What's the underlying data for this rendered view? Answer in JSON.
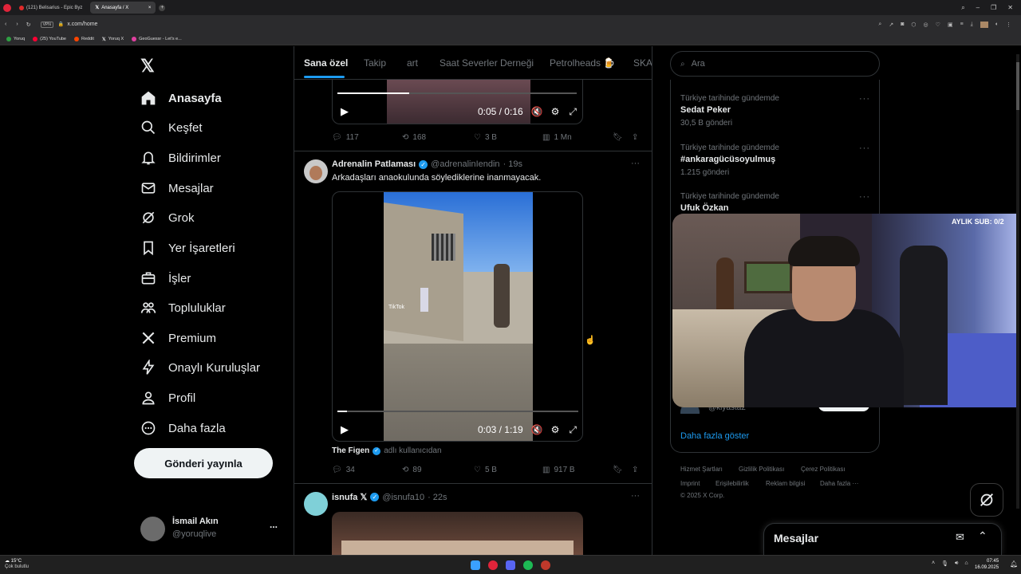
{
  "browser": {
    "tabs": [
      {
        "label": "(121) Belisarius - Epic Byz"
      },
      {
        "label": "Anasayfa / X"
      }
    ],
    "url": "x.com/home",
    "vpn": "VPN",
    "bookmarks": [
      {
        "label": "Yoruq",
        "color": "#2ea043"
      },
      {
        "label": "(25) YouTube",
        "color": "#ff0033"
      },
      {
        "label": "Reddit",
        "color": "#ff4500"
      },
      {
        "label": "Yoruq X",
        "color": "#ffffff"
      },
      {
        "label": "GeoGuessr - Let's e...",
        "color": "#e040a0"
      }
    ]
  },
  "sidebar": {
    "items": [
      {
        "label": "Anasayfa",
        "icon": "home-icon"
      },
      {
        "label": "Keşfet",
        "icon": "search-icon"
      },
      {
        "label": "Bildirimler",
        "icon": "bell-icon"
      },
      {
        "label": "Mesajlar",
        "icon": "mail-icon"
      },
      {
        "label": "Grok",
        "icon": "grok-icon"
      },
      {
        "label": "Yer İşaretleri",
        "icon": "bookmark-icon"
      },
      {
        "label": "İşler",
        "icon": "briefcase-icon"
      },
      {
        "label": "Topluluklar",
        "icon": "people-icon"
      },
      {
        "label": "Premium",
        "icon": "x-logo-icon"
      },
      {
        "label": "Onaylı Kuruluşlar",
        "icon": "lightning-icon"
      },
      {
        "label": "Profil",
        "icon": "person-icon"
      },
      {
        "label": "Daha fazla",
        "icon": "more-circle-icon"
      }
    ],
    "post_button": "Gönderi yayınla",
    "account": {
      "name": "İsmail Akın",
      "handle": "@yoruqlive",
      "more": "..."
    }
  },
  "feed": {
    "tabs": [
      "Sana özel",
      "Takip",
      "art",
      "Saat Severler Derneği",
      "Petrolheads 🍺",
      "SKA"
    ],
    "post1": {
      "video_time": "0:05 / 0:16",
      "video_progress": 0.3,
      "stats": {
        "replies": "117",
        "reposts": "168",
        "likes": "3 B",
        "views": "1 Mn"
      }
    },
    "post2": {
      "name": "Adrenalin Patlaması",
      "handle": "@adrenalinIendin",
      "time": "· 19s",
      "text": "Arkadaşları anaokulunda söylediklerine inanmayacak.",
      "video_time": "0:03 / 1:19",
      "video_progress": 0.04,
      "watermark": "TikTok",
      "source_name": "The Figen",
      "source_suffix": "adlı kullanıcıdan",
      "stats": {
        "replies": "34",
        "reposts": "89",
        "likes": "5 B",
        "views": "917 B"
      }
    },
    "post3": {
      "name": "isnufa 𝕏",
      "handle": "@isnufa10",
      "time": "· 22s"
    }
  },
  "right": {
    "search_placeholder": "Ara",
    "trends": [
      {
        "category": "Türkiye tarihinde gündemde",
        "name": "Sedat Peker",
        "count": "30,5 B gönderi"
      },
      {
        "category": "Türkiye tarihinde gündemde",
        "name": "#ankaragücüsoyulmuş",
        "count": "1.215 gönderi"
      },
      {
        "category": "Türkiye tarihinde gündemde",
        "name": "Ufuk Özkan",
        "count": ""
      }
    ],
    "follow_handle": "@kiyasta2",
    "show_more": "Daha fazla göster",
    "footer": [
      "Hizmet Şartları",
      "Gizlilik Politikası",
      "Çerez Politikası",
      "Imprint",
      "Erişilebilirlik",
      "Reklam bilgisi",
      "Daha fazla ···",
      "© 2025 X Corp."
    ]
  },
  "overlay": {
    "sub_counter": "AYLIK SUB: 0/2"
  },
  "messages_dock": {
    "title": "Mesajlar"
  },
  "taskbar": {
    "weather_temp": "15°C",
    "weather_desc": "Çok bulutlu",
    "time": "07:45",
    "date": "16.09.2025"
  }
}
